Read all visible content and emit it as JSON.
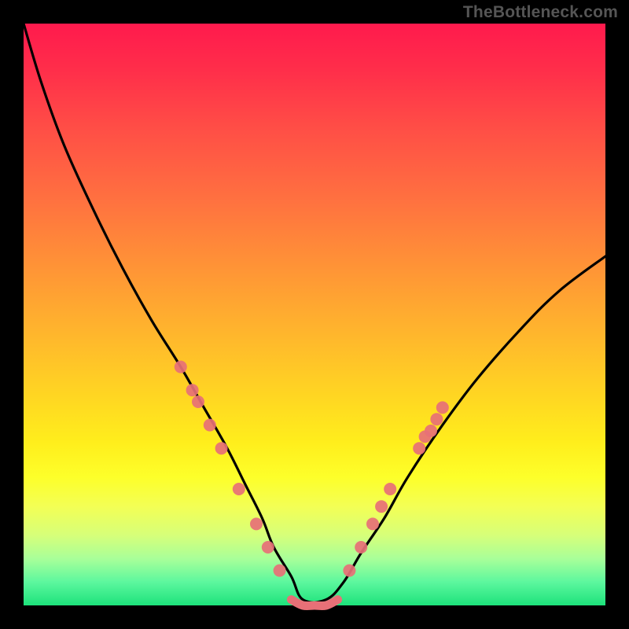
{
  "attribution": "TheBottleneck.com",
  "chart_data": {
    "type": "line",
    "title": "",
    "xlabel": "",
    "ylabel": "",
    "ylim": [
      0,
      100
    ],
    "xlim": [
      0,
      100
    ],
    "series": [
      {
        "name": "curve",
        "x": [
          0,
          3,
          7,
          12,
          17,
          22,
          27,
          31,
          35,
          38,
          41,
          43,
          46,
          48,
          52,
          55,
          58,
          62,
          66,
          72,
          78,
          85,
          92,
          100
        ],
        "y": [
          100,
          90,
          79,
          68,
          58,
          49,
          41,
          34,
          27,
          21,
          15,
          10,
          5,
          1,
          1,
          4,
          9,
          15,
          22,
          31,
          39,
          47,
          54,
          60
        ]
      },
      {
        "name": "bottom-flat",
        "x": [
          46,
          48,
          50,
          52,
          54
        ],
        "y": [
          1,
          0,
          0,
          0,
          1
        ]
      }
    ],
    "markers_left": [
      {
        "x": 27,
        "y": 41
      },
      {
        "x": 29,
        "y": 37
      },
      {
        "x": 30,
        "y": 35
      },
      {
        "x": 32,
        "y": 31
      },
      {
        "x": 34,
        "y": 27
      },
      {
        "x": 37,
        "y": 20
      },
      {
        "x": 40,
        "y": 14
      },
      {
        "x": 42,
        "y": 10
      },
      {
        "x": 44,
        "y": 6
      }
    ],
    "markers_right": [
      {
        "x": 56,
        "y": 6
      },
      {
        "x": 58,
        "y": 10
      },
      {
        "x": 60,
        "y": 14
      },
      {
        "x": 61.5,
        "y": 17
      },
      {
        "x": 63,
        "y": 20
      },
      {
        "x": 68,
        "y": 27
      },
      {
        "x": 69,
        "y": 29
      },
      {
        "x": 70,
        "y": 30
      },
      {
        "x": 71,
        "y": 32
      },
      {
        "x": 72,
        "y": 34
      }
    ],
    "marker_color": "#e77077",
    "curve_stroke": "#000000",
    "bottom_stroke": "#e77077"
  }
}
